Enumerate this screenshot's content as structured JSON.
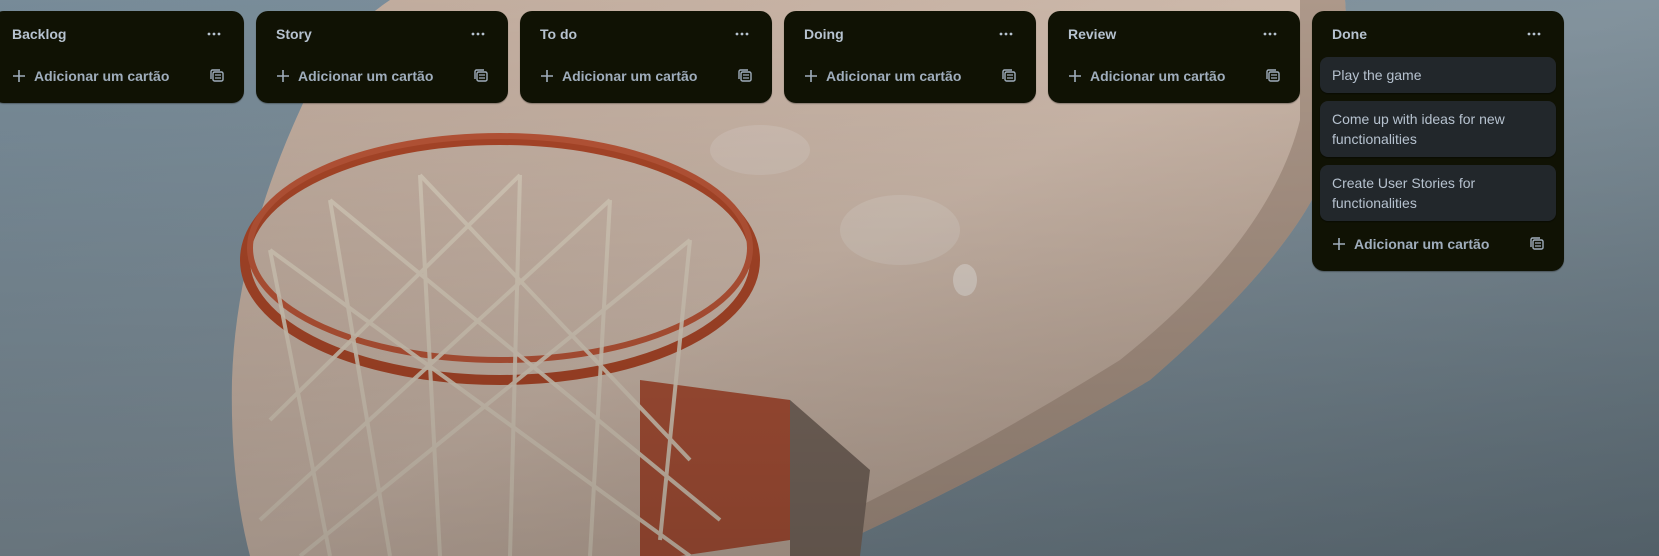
{
  "colors": {
    "list_background": "#101204",
    "card_background": "#22272b",
    "text": "#b6c2cf",
    "muted_text": "#9fadbc"
  },
  "lists": [
    {
      "title": "Backlog",
      "menu_icon": "more-horizontal-icon",
      "cards": [],
      "add_card_label": "Adicionar um cartão",
      "template_icon": "card-template-icon"
    },
    {
      "title": "Story",
      "menu_icon": "more-horizontal-icon",
      "cards": [],
      "add_card_label": "Adicionar um cartão",
      "template_icon": "card-template-icon"
    },
    {
      "title": "To do",
      "menu_icon": "more-horizontal-icon",
      "cards": [],
      "add_card_label": "Adicionar um cartão",
      "template_icon": "card-template-icon"
    },
    {
      "title": "Doing",
      "menu_icon": "more-horizontal-icon",
      "cards": [],
      "add_card_label": "Adicionar um cartão",
      "template_icon": "card-template-icon"
    },
    {
      "title": "Review",
      "menu_icon": "more-horizontal-icon",
      "cards": [],
      "add_card_label": "Adicionar um cartão",
      "template_icon": "card-template-icon"
    },
    {
      "title": "Done",
      "menu_icon": "more-horizontal-icon",
      "cards": [
        {
          "title": "Play the game"
        },
        {
          "title": "Come up with ideas for new functionalities"
        },
        {
          "title": "Create User Stories for functionalities"
        }
      ],
      "add_card_label": "Adicionar um cartão",
      "template_icon": "card-template-icon"
    }
  ]
}
